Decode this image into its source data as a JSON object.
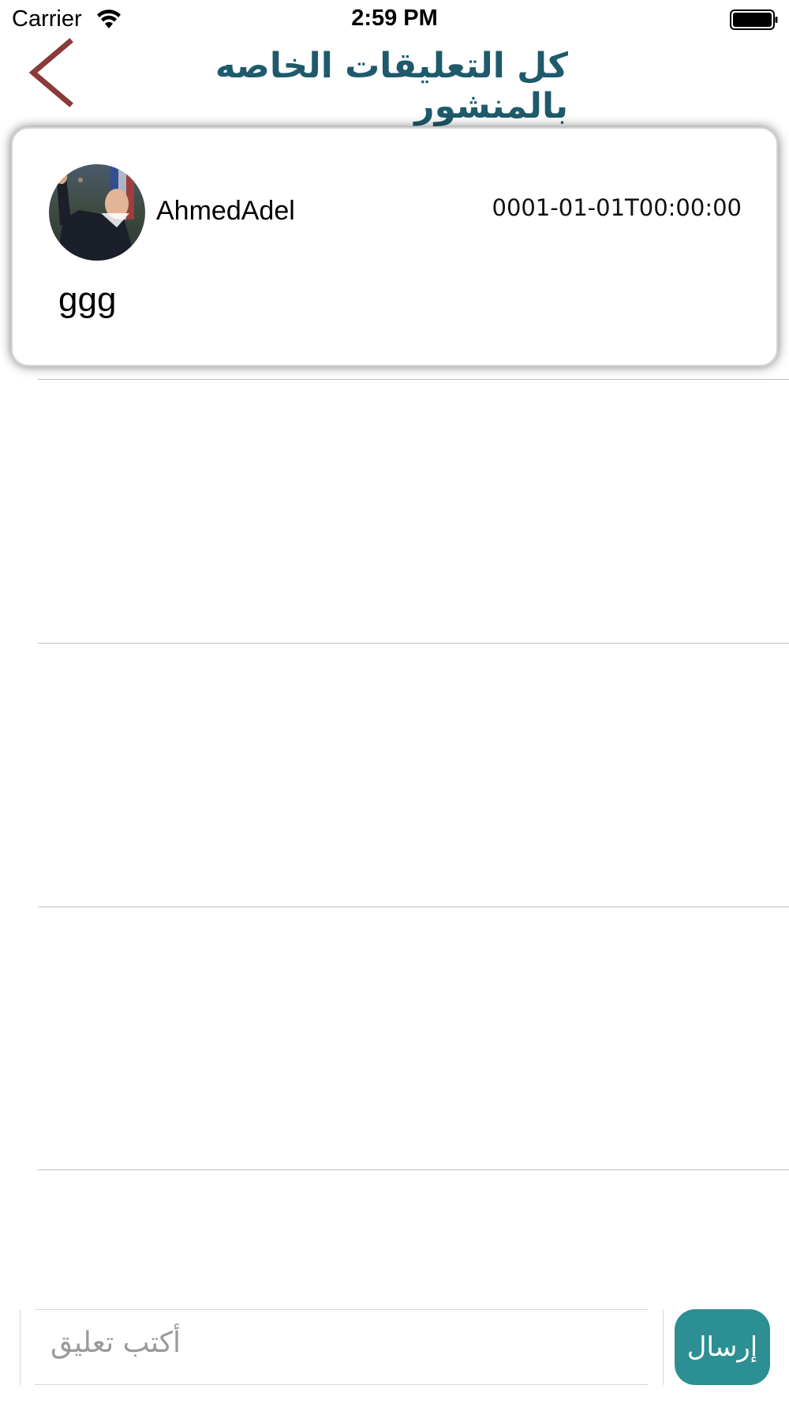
{
  "status_bar": {
    "carrier": "Carrier",
    "time": "2:59 PM",
    "wifi_icon": "wifi-icon",
    "battery_icon": "battery-icon"
  },
  "nav": {
    "back_icon": "chevron-left-icon",
    "back_color": "#8b3a3a",
    "title": "كل التعليقات الخاصه بالمنشور",
    "title_color": "#1e5a6b"
  },
  "comments": [
    {
      "user": "AhmedAdel",
      "date": "0001-01-01T00:00:00",
      "text": "ggg",
      "avatar_icon": "avatar-photo"
    }
  ],
  "composer": {
    "placeholder": "أكتب تعليق",
    "send_label": "إرسال",
    "send_color": "#2b8f93"
  }
}
